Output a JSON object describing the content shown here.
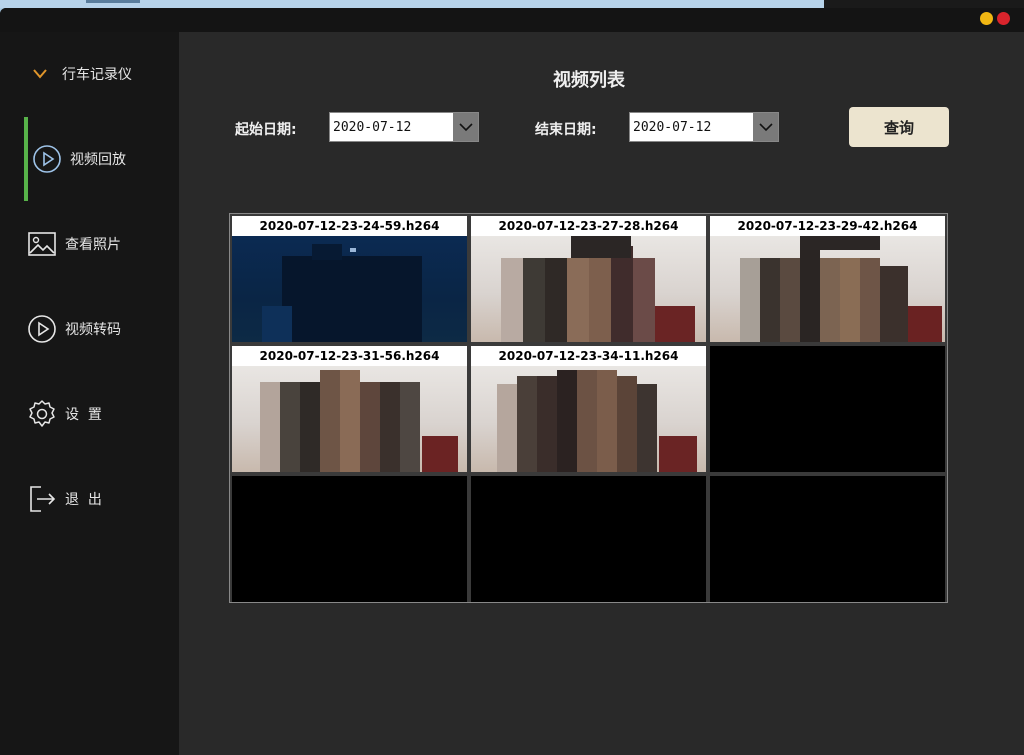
{
  "window": {
    "title": "视频列表"
  },
  "sidebar": {
    "header": "行车记录仪",
    "items": [
      {
        "label": "视频回放",
        "icon": "play-circle-icon",
        "active": true
      },
      {
        "label": "查看照片",
        "icon": "image-icon",
        "active": false
      },
      {
        "label": "视频转码",
        "icon": "play-circle-icon",
        "active": false
      },
      {
        "label": "设  置",
        "icon": "gear-icon",
        "active": false
      },
      {
        "label": "退  出",
        "icon": "logout-icon",
        "active": false
      }
    ]
  },
  "filters": {
    "start_label": "起始日期:",
    "start_value": "2020-07-12",
    "end_label": "结束日期:",
    "end_value": "2020-07-12",
    "query_label": "查询"
  },
  "videos": [
    {
      "name": "2020-07-12-23-24-59.h264",
      "thumb": "dark"
    },
    {
      "name": "2020-07-12-23-27-28.h264",
      "thumb": "room"
    },
    {
      "name": "2020-07-12-23-29-42.h264",
      "thumb": "room"
    },
    {
      "name": "2020-07-12-23-31-56.h264",
      "thumb": "room"
    },
    {
      "name": "2020-07-12-23-34-11.h264",
      "thumb": "room"
    }
  ],
  "colors": {
    "accent_active": "#58b34a",
    "sidebar_bg": "#161616",
    "main_bg": "#292929",
    "query_button_bg": "#ece4cf",
    "minimize": "#f1b713",
    "close": "#d9242c"
  }
}
